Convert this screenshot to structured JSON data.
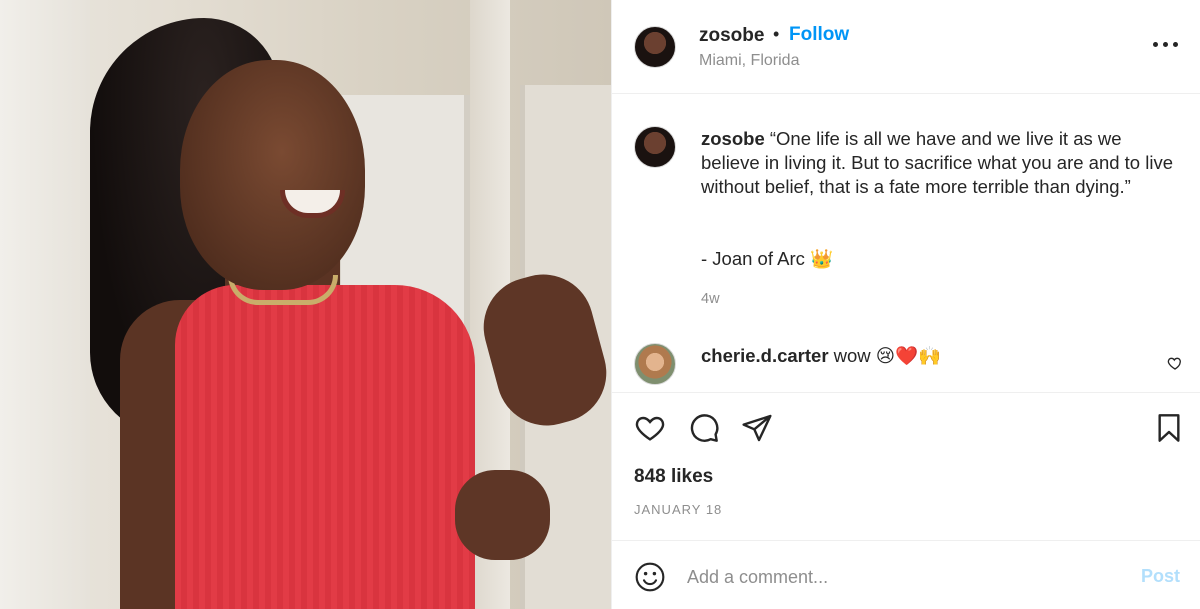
{
  "post": {
    "username": "zosobe",
    "separator": "•",
    "follow_label": "Follow",
    "location": "Miami, Florida",
    "more_icon": "more-options-icon"
  },
  "caption": {
    "username": "zosobe",
    "text": " “One life is all we have and we live it as we believe in living it. But to sacrifice what you are and to live without belief, that is a fate more terrible than dying.”",
    "signature": "- Joan of Arc 👑",
    "time": "4w"
  },
  "comment": {
    "username": "cherie.d.carter",
    "text": " wow 😢❤️🙌"
  },
  "actions": {
    "like_icon": "heart-icon",
    "comment_icon": "comment-bubble-icon",
    "share_icon": "paper-plane-icon",
    "save_icon": "bookmark-icon"
  },
  "stats": {
    "likes": "848 likes",
    "date": "JANUARY 18"
  },
  "add_comment": {
    "placeholder": "Add a comment...",
    "post_label": "Post"
  },
  "colors": {
    "accent": "#0095f6",
    "post_disabled": "#b2dffc",
    "text": "#262626",
    "muted": "#8e8e8e"
  }
}
